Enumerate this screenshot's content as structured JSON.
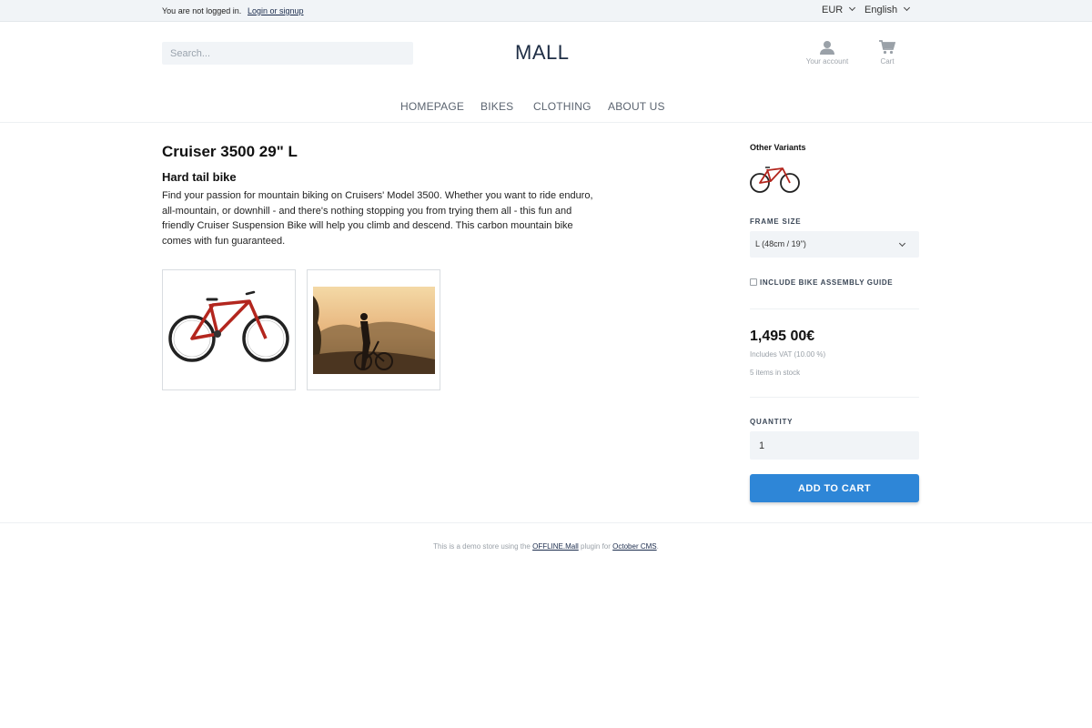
{
  "topbar": {
    "status": "You are not logged in.",
    "login_link": "Login or signup",
    "currency": "EUR",
    "language": "English"
  },
  "header": {
    "search_placeholder": "Search...",
    "logo": "MALL",
    "account_label": "Your account",
    "cart_label": "Cart",
    "icons": [
      "person-icon",
      "cart-icon"
    ]
  },
  "nav": {
    "items": [
      "HOMEPAGE",
      "BIKES",
      "CLOTHING",
      "ABOUT US"
    ]
  },
  "product": {
    "title": "Cruiser 3500 29\" L",
    "subtitle": "Hard tail bike",
    "description": "Find your passion for mountain biking on Cruisers' Model 3500. Whether you want to ride enduro, all-mountain, or downhill - and there's nothing stopping you from trying them all - this fun and friendly Cruiser Suspension Bike will help you climb and descend. This carbon mountain bike comes with fun guaranteed."
  },
  "panel": {
    "other_variants": "Other Variants",
    "frame_size_label": "FRAME SIZE",
    "frame_size_value": "L (48cm / 19\")",
    "assembly_label": "INCLUDE BIKE ASSEMBLY GUIDE",
    "price": "1,495 00€",
    "vat": "Includes VAT (10.00 %)",
    "stock": "5 items in stock",
    "quantity_label": "QUANTITY",
    "quantity_value": "1",
    "add_to_cart": "ADD TO CART"
  },
  "footer": {
    "prefix": "This is a demo store using the",
    "link1": "OFFLINE.Mall",
    "middle": "plugin for",
    "link2": "October CMS",
    "suffix": "."
  },
  "colors": {
    "accent": "#2e86d7",
    "topbar_bg": "#f1f4f7",
    "bike_red": "#b3261e"
  }
}
